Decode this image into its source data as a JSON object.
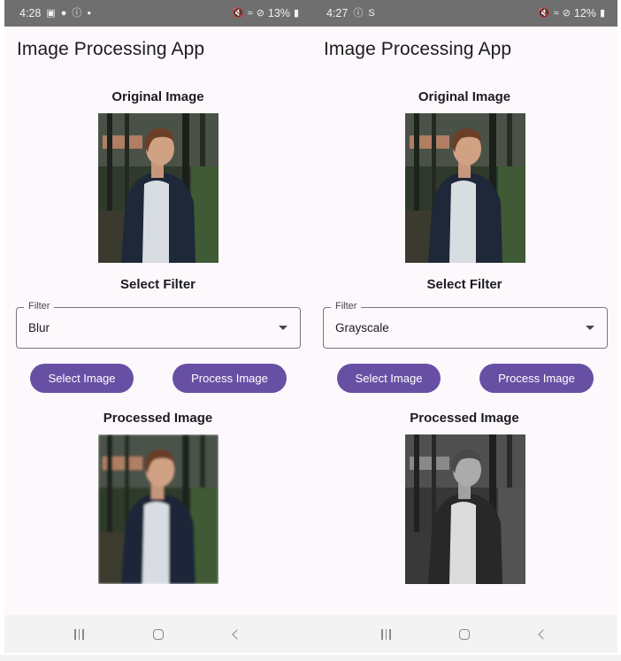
{
  "screens": [
    {
      "status_bar": {
        "time": "4:28",
        "left_icons": [
          "gallery-icon",
          "bulb-icon",
          "alert-circle-icon",
          "dot-icon"
        ],
        "right_icons": [
          "mute-icon",
          "wifi-icon",
          "do-not-disturb-icon"
        ],
        "battery": "13%"
      },
      "app_title": "Image Processing App",
      "original_label": "Original Image",
      "select_filter_label": "Select Filter",
      "filter": {
        "label": "Filter",
        "value": "Blur"
      },
      "buttons": {
        "select": "Select Image",
        "process": "Process Image"
      },
      "processed_label": "Processed Image",
      "processed_effect": "blur"
    },
    {
      "status_bar": {
        "time": "4:27",
        "left_icons": [
          "alert-circle-icon",
          "s-icon"
        ],
        "right_icons": [
          "mute-icon",
          "wifi-icon",
          "do-not-disturb-icon"
        ],
        "battery": "12%"
      },
      "app_title": "Image Processing App",
      "original_label": "Original Image",
      "select_filter_label": "Select Filter",
      "filter": {
        "label": "Filter",
        "value": "Grayscale"
      },
      "buttons": {
        "select": "Select Image",
        "process": "Process Image"
      },
      "processed_label": "Processed Image",
      "processed_effect": "grayscale"
    }
  ],
  "nav_bar": {
    "buttons": [
      "recents",
      "home",
      "back"
    ]
  },
  "colors": {
    "primary": "#6750a4",
    "status_bar": "#6f6f6f",
    "background": "#fdf8fc",
    "nav_bar": "#f3f3f3"
  }
}
